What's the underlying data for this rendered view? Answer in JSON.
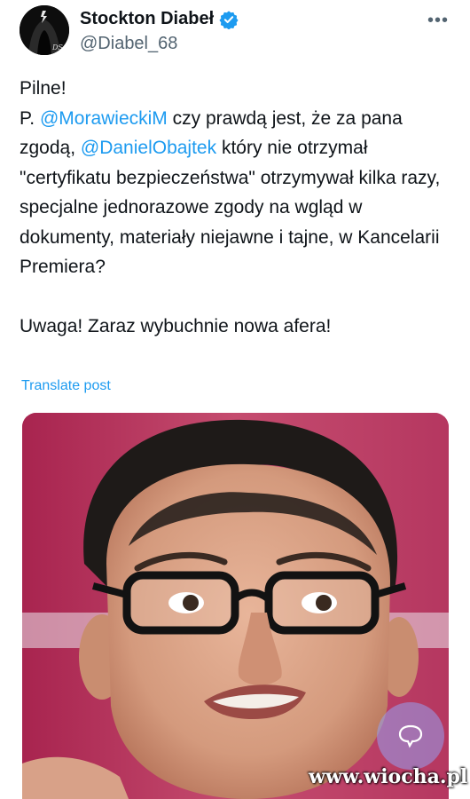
{
  "author": {
    "display_name": "Stockton Diabeł",
    "handle": "@Diabel_68",
    "avatar_icon": "hooded-figure-avatar",
    "avatar_initials": "DS",
    "verified_icon": "verified-badge-icon",
    "verified_color": "#1d9bf0"
  },
  "menu": {
    "more_label": "•••"
  },
  "post": {
    "line1": "Pilne!",
    "line2_prefix": "P. ",
    "mention1": "@MorawieckiM",
    "line2_after": " czy prawdą jest, że za pana zgodą, ",
    "mention2": "@DanielObajtek",
    "line2_rest": " który nie otrzymał \"certyfikatu bezpieczeństwa\" otrzymywał kilka razy, specjalne jednorazowe zgody na wgląd w dokumenty, materiały niejawne i tajne, w Kancelarii Premiera?",
    "line3": "Uwaga! Zaraz wybuchnie nowa afera!",
    "translate_label": "Translate post"
  },
  "media": {
    "description_icon": "photo-of-man-with-glasses",
    "fab_icon": "chat-bubble-icon"
  },
  "watermark": {
    "text": "www.wiocha.pl"
  },
  "colors": {
    "link": "#1d9bf0",
    "text": "#0f1419",
    "secondary": "#536471"
  }
}
